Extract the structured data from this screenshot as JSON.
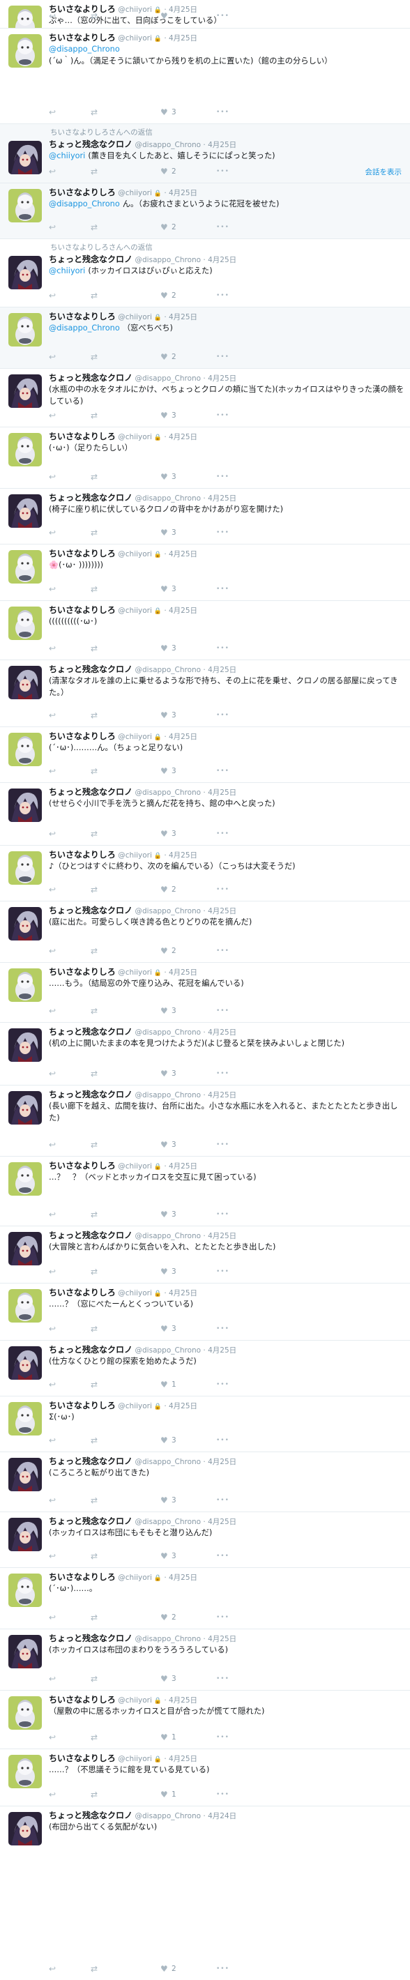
{
  "users": {
    "chiiyori": {
      "name": "ちいさなよりしろ",
      "handle": "@chiiyori"
    },
    "chrono": {
      "name": "ちょっと残念なクロノ",
      "handle": "@disappo_Chrono"
    }
  },
  "colors": {
    "accent": "#1b95e0",
    "muted": "#8899a6",
    "icon": "#aab8c2",
    "divider": "#e6ecf0",
    "conversation_bg": "#f5f8fa"
  },
  "icons": {
    "reply": "reply-icon",
    "retweet": "retweet-icon",
    "like": "heart-icon",
    "more": "more-dots-icon",
    "lock": "lock-icon"
  },
  "show_conversation_label": "会話を表示",
  "tweets": [
    {
      "user": "chiiyori",
      "date": "4月25日",
      "text": "ぷゃ…（窓の外に出て、日向ぼっこをしている）"
    },
    {
      "user": "chiiyori",
      "date": "4月25日",
      "mention": "@disappo_Chrono",
      "text": "(´ω｀)ん。（満足そうに頷いてから残りを机の上に置いた)（館の主の分らしい）",
      "likes": "3"
    },
    {
      "user": "chrono",
      "date": "4月25日",
      "context": "ちいさなよりしろさんへの返信",
      "mention": "@chiiyori",
      "text": "(薫き目を丸くしたあと、嬉しそうににぱっと笑った)",
      "likes": "2",
      "conversation": true,
      "show_conversation": true
    },
    {
      "user": "chiiyori",
      "date": "4月25日",
      "mention": "@disappo_Chrono",
      "text": "ん。（お疲れさまというように花冠を被せた)",
      "likes": "2",
      "conversation": true
    },
    {
      "user": "chrono",
      "date": "4月25日",
      "context": "ちいさなよりしろさんへの返信",
      "mention": "@chiiyori",
      "text": "(ホッカイロスはぴぃぴぃと応えた)",
      "likes": "2"
    },
    {
      "user": "chiiyori",
      "date": "4月25日",
      "mention": "@disappo_Chrono",
      "text": "（窓べちべち)",
      "likes": "2",
      "conversation": true
    },
    {
      "user": "chrono",
      "date": "4月25日",
      "text": "(水瓶の中の水をタオルにかけ、ぺちょっとクロノの頬に当てた)(ホッカイロスはやりきった漢の顔をしている)",
      "likes": "3"
    },
    {
      "user": "chiiyori",
      "date": "4月25日",
      "text": "(･ω･)（足りたらしい）",
      "likes": "3"
    },
    {
      "user": "chrono",
      "date": "4月25日",
      "text": "(椅子に座り机に伏しているクロノの背中をかけあがり窓を開けた)",
      "likes": "3"
    },
    {
      "user": "chiiyori",
      "date": "4月25日",
      "text": "🌸(･ω･ ))))))))",
      "likes": "3"
    },
    {
      "user": "chiiyori",
      "date": "4月25日",
      "text": "((((((((((･ω･)",
      "likes": "3"
    },
    {
      "user": "chrono",
      "date": "4月25日",
      "text": "(清潔なタオルを誰の上に乗せるような形で持ち、その上に花を乗せ、クロノの居る部屋に戻ってきた。）",
      "likes": "3"
    },
    {
      "user": "chiiyori",
      "date": "4月25日",
      "text": "(´･ω･)………ん。（ちょっと足りない)",
      "likes": "3"
    },
    {
      "user": "chrono",
      "date": "4月25日",
      "text": "(せせらぐ小川で手を洗うと摘んだ花を持ち、館の中へと戻った)",
      "likes": "3"
    },
    {
      "user": "chiiyori",
      "date": "4月25日",
      "text": "♪（ひとつはすぐに終わり、次のを編んでいる）（こっちは大変そうだ)",
      "likes": "2"
    },
    {
      "user": "chrono",
      "date": "4月25日",
      "text": "(庭に出た。可愛らしく咲き誇る色とりどりの花を摘んだ)",
      "likes": "2"
    },
    {
      "user": "chiiyori",
      "date": "4月25日",
      "text": "……もう。（結局窓の外で座り込み、花冠を編んでいる)",
      "likes": "3"
    },
    {
      "user": "chrono",
      "date": "4月25日",
      "text": "(机の上に開いたままの本を見つけたようだ)(よじ登ると栞を挟みよいしょと閉じた)",
      "likes": "3"
    },
    {
      "user": "chrono",
      "date": "4月25日",
      "text": "(長い廊下を越え、広間を抜け、台所に出た。小さな水瓶に水を入れると、またとたとたと歩き出した)",
      "likes": "3"
    },
    {
      "user": "chiiyori",
      "date": "4月25日",
      "text": "…？　？（ベッドとホッカイロスを交互に見て困っている)",
      "likes": "3"
    },
    {
      "user": "chrono",
      "date": "4月25日",
      "text": "(大冒険と言わんばかりに気合いを入れ、とたとたと歩き出した)",
      "likes": "3"
    },
    {
      "user": "chiiyori",
      "date": "4月25日",
      "text": "……？（窓にぺたーんとくっついている)",
      "likes": "3"
    },
    {
      "user": "chrono",
      "date": "4月25日",
      "text": "(仕方なくひとり館の探索を始めたようだ)",
      "likes": "1"
    },
    {
      "user": "chiiyori",
      "date": "4月25日",
      "text": "Σ(･ω･)",
      "likes": "3"
    },
    {
      "user": "chrono",
      "date": "4月25日",
      "text": "(ころころと転がり出てきた)",
      "likes": "3"
    },
    {
      "user": "chrono",
      "date": "4月25日",
      "text": "(ホッカイロスは布団にもそもそと潜り込んだ)",
      "likes": "3"
    },
    {
      "user": "chiiyori",
      "date": "4月25日",
      "text": "(´･ω･)……。",
      "likes": "2"
    },
    {
      "user": "chrono",
      "date": "4月25日",
      "text": "(ホッカイロスは布団のまわりをうろうろしている)",
      "likes": "3"
    },
    {
      "user": "chiiyori",
      "date": "4月25日",
      "text": "（屋敷の中に居るホッカイロスと目が合ったが慌てて隠れた)",
      "likes": "1"
    },
    {
      "user": "chiiyori",
      "date": "4月25日",
      "text": "……？（不思議そうに館を見ている見ている)",
      "likes": "1"
    },
    {
      "user": "chrono",
      "date": "4月24日",
      "text": "(布団から出てくる気配がない)",
      "likes": "2"
    }
  ]
}
